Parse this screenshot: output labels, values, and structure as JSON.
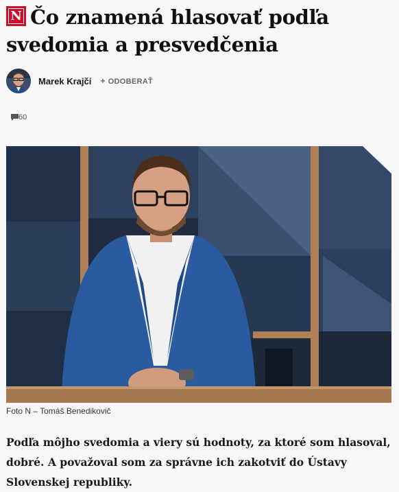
{
  "article": {
    "logo_letter": "N",
    "title": "Čo znamená hlasovať podľa svedomia a presvedčenia",
    "author": {
      "name": "Marek Krajčí",
      "subscribe_label": "ODOBERAŤ",
      "subscribe_icon": "+"
    },
    "comments": {
      "count": "60",
      "icon": "comment-icon"
    },
    "photo": {
      "caption": "Foto N – Tomáš Benedikovič"
    },
    "perex": "Podľa môjho svedomia a viery sú hodnoty, za ktoré som hlasoval, dobré. A považoval som za správne ich zakotviť do Ústavy Slovenskej republiky."
  },
  "colors": {
    "brand": "#c8102e",
    "background": "#f7f7f7"
  }
}
